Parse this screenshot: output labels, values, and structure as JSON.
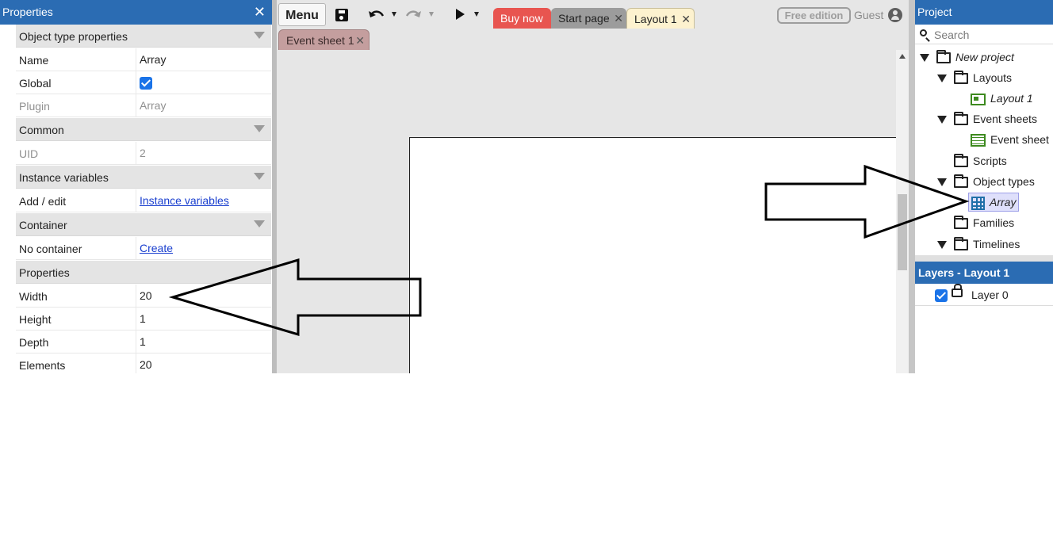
{
  "properties_panel": {
    "title": "Properties",
    "rows": [
      {
        "kind": "section",
        "name": "Object type properties"
      },
      {
        "kind": "text",
        "name": "Name",
        "value": "Array"
      },
      {
        "kind": "checkbox",
        "name": "Global",
        "checked": true
      },
      {
        "kind": "text",
        "name": "Plugin",
        "value": "Array",
        "disabled": true
      },
      {
        "kind": "section",
        "name": "Common"
      },
      {
        "kind": "text",
        "name": "UID",
        "value": "2",
        "disabled": true
      },
      {
        "kind": "section",
        "name": "Instance variables"
      },
      {
        "kind": "link",
        "name": "Add / edit",
        "value": "Instance variables"
      },
      {
        "kind": "section",
        "name": "Container"
      },
      {
        "kind": "link",
        "name": "No container",
        "value": "Create"
      },
      {
        "kind": "section",
        "name": "Properties"
      },
      {
        "kind": "text",
        "name": "Width",
        "value": "20"
      },
      {
        "kind": "text",
        "name": "Height",
        "value": "1"
      },
      {
        "kind": "text",
        "name": "Depth",
        "value": "1"
      },
      {
        "kind": "text",
        "name": "Elements",
        "value": "20"
      }
    ]
  },
  "toolbar": {
    "menu_label": "Menu",
    "free_edition": "Free edition",
    "guest": "Guest"
  },
  "tabs": {
    "buy_now": "Buy now",
    "start_page": "Start page",
    "layout_1": "Layout 1",
    "event_sheet_1": "Event sheet 1",
    "close_glyph": "✕"
  },
  "project_panel": {
    "title": "Project",
    "search_placeholder": "Search",
    "items": {
      "root": "New project",
      "layouts": "Layouts",
      "layout_1": "Layout 1",
      "event_sheets": "Event sheets",
      "event_sheet": "Event sheet",
      "scripts": "Scripts",
      "object_types": "Object types",
      "array": "Array",
      "families": "Families",
      "timelines": "Timelines"
    }
  },
  "layers_panel": {
    "title": "Layers - Layout 1",
    "layer_name": "Layer 0",
    "layer_visible": true
  },
  "colors": {
    "title_bar": "#2b6cb3",
    "buy_tab": "#e85550",
    "layout_tab": "#fdf2cf",
    "event_tab": "#c49e9e",
    "selected_item": "#dfe0fb"
  }
}
